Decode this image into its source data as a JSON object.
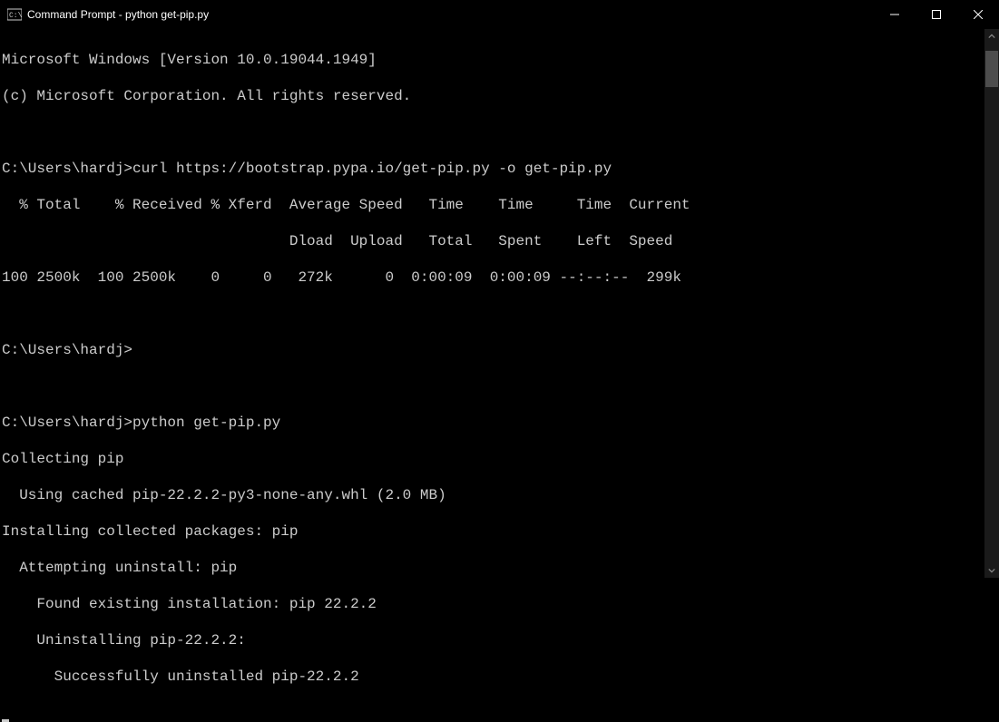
{
  "titlebar": {
    "title": "Command Prompt - python  get-pip.py"
  },
  "terminal": {
    "lines": [
      "Microsoft Windows [Version 10.0.19044.1949]",
      "(c) Microsoft Corporation. All rights reserved.",
      "",
      "C:\\Users\\hardj>curl https://bootstrap.pypa.io/get-pip.py -o get-pip.py",
      "  % Total    % Received % Xferd  Average Speed   Time    Time     Time  Current",
      "                                 Dload  Upload   Total   Spent    Left  Speed",
      "100 2500k  100 2500k    0     0   272k      0  0:00:09  0:00:09 --:--:--  299k",
      "",
      "C:\\Users\\hardj>",
      "",
      "C:\\Users\\hardj>python get-pip.py",
      "Collecting pip",
      "  Using cached pip-22.2.2-py3-none-any.whl (2.0 MB)",
      "Installing collected packages: pip",
      "  Attempting uninstall: pip",
      "    Found existing installation: pip 22.2.2",
      "    Uninstalling pip-22.2.2:",
      "      Successfully uninstalled pip-22.2.2"
    ]
  }
}
